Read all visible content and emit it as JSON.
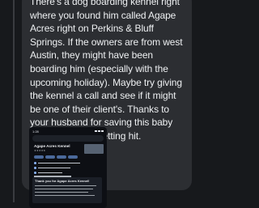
{
  "comment": {
    "text": "There's a dog boarding kennel right where you found him called Agape Acres right on Perkins & Bluff Springs. If the owners are from west Austin, they might have been boarding him (especially with the upcoming holiday). Maybe try giving the kennel a call and see if it might be one of their client's. Thanks to your husband for saving this baby from potentially getting hit."
  },
  "screenshot": {
    "status_time": "1:28",
    "place_name": "Agape Acres Kennel",
    "review_title": "Thank you for Agape Acres Kennel!"
  },
  "colors": {
    "background": "#17191c",
    "bubble": "#2c2e32",
    "text": "#eef0f2",
    "accent": "#8ab4f8"
  }
}
